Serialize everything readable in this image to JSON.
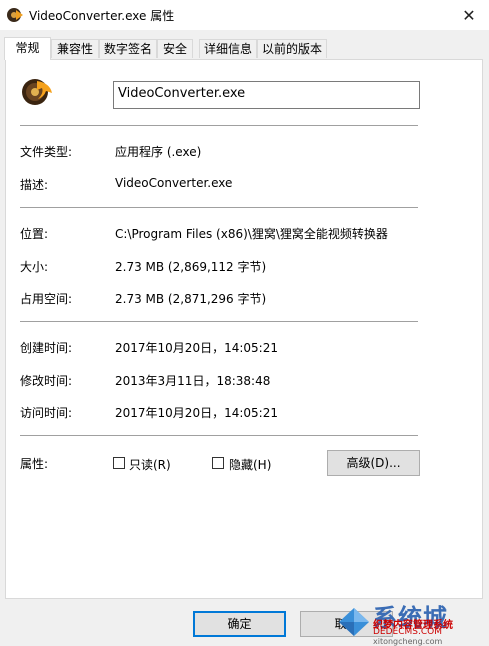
{
  "window": {
    "title": "VideoConverter.exe 属性",
    "close_glyph": "✕"
  },
  "tabs": [
    {
      "label": "常规"
    },
    {
      "label": "兼容性"
    },
    {
      "label": "数字签名"
    },
    {
      "label": "安全"
    },
    {
      "label": "详细信息"
    },
    {
      "label": "以前的版本"
    }
  ],
  "general": {
    "filename": "VideoConverter.exe",
    "rows1": [
      {
        "label": "文件类型:",
        "value": "应用程序 (.exe)"
      },
      {
        "label": "描述:",
        "value": "VideoConverter.exe"
      }
    ],
    "rows2": [
      {
        "label": "位置:",
        "value": "C:\\Program Files (x86)\\狸窝\\狸窝全能视频转换器"
      },
      {
        "label": "大小:",
        "value": "2.73 MB (2,869,112 字节)"
      },
      {
        "label": "占用空间:",
        "value": "2.73 MB (2,871,296 字节)"
      }
    ],
    "rows3": [
      {
        "label": "创建时间:",
        "value": "2017年10月20日，14:05:21"
      },
      {
        "label": "修改时间:",
        "value": "2013年3月11日，18:38:48"
      },
      {
        "label": "访问时间:",
        "value": "2017年10月20日，14:05:21"
      }
    ],
    "attributes": {
      "label": "属性:",
      "readonly": {
        "label": "只读(R)",
        "checked": false
      },
      "hidden": {
        "label": "隐藏(H)",
        "checked": false
      },
      "advanced_label": "高级(D)..."
    }
  },
  "footer": {
    "ok_label": "确定",
    "cancel_label": "取消"
  },
  "watermark": {
    "line1": "系统城",
    "line2": "织梦内容管理系统",
    "line3": "DEDECMS.COM",
    "line4": "xitongcheng.com"
  }
}
